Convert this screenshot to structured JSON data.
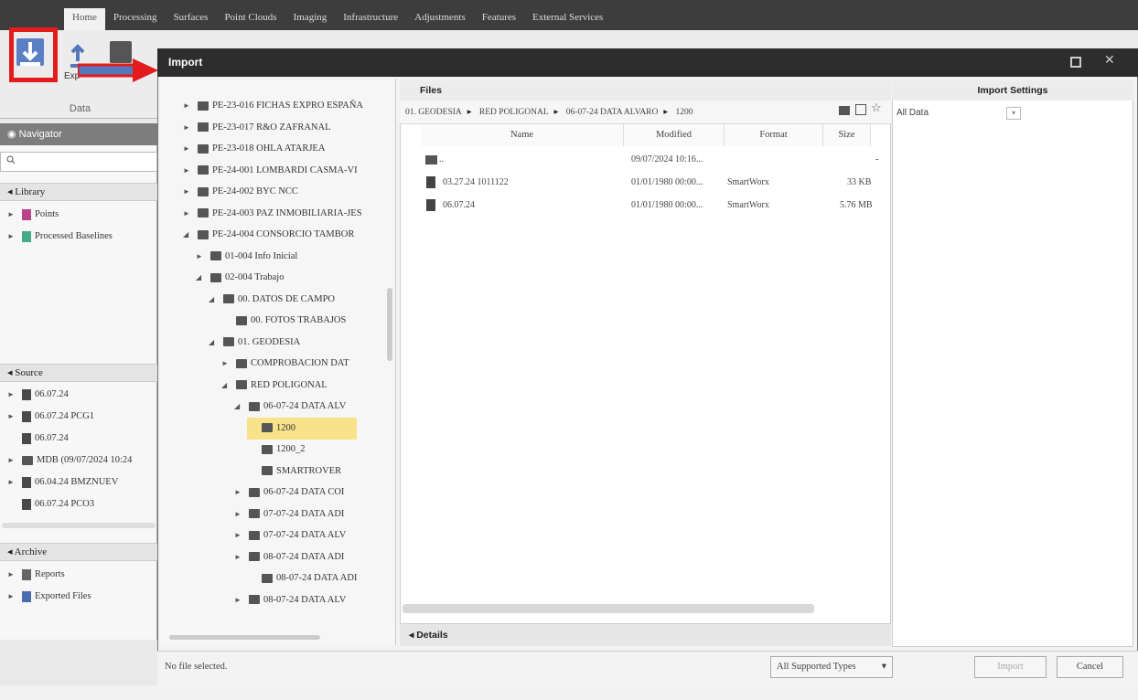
{
  "menubar": {
    "tabs": [
      "Home",
      "Processing",
      "Surfaces",
      "Point Clouds",
      "Imaging",
      "Infrastructure",
      "Adjustments",
      "Features",
      "External Services"
    ]
  },
  "ribbon": {
    "group_data": "Data",
    "export_label": "Exp"
  },
  "navigator": {
    "title": "Navigator",
    "search_placeholder": "",
    "library": {
      "label": "Library",
      "items": [
        "Points",
        "Processed Baselines"
      ]
    },
    "source": {
      "label": "Source",
      "items": [
        "06.07.24",
        "06.07.24 PCG1",
        "06.07.24",
        "MDB (09/07/2024 10:24",
        "06.04.24 BMZNUEV",
        "06.07.24 PCO3"
      ]
    },
    "archive": {
      "label": "Archive",
      "items": [
        "Reports",
        "Exported Files"
      ]
    }
  },
  "dialog": {
    "title": "Import",
    "tree": [
      "PE-23-016 FICHAS EXPRO ESPAÑA",
      "PE-23-017 R&O ZAFRANAL",
      "PE-23-018 OHLA ATARJEA",
      "PE-24-001 LOMBARDI CASMA-VI",
      "PE-24-002 BYC NCC",
      "PE-24-003 PAZ INMOBILIARIA-JES",
      "PE-24-004 CONSORCIO TAMBOR",
      "01-004 Info Inicial",
      "02-004 Trabajo",
      "00. DATOS DE CAMPO",
      "00. FOTOS TRABAJOS",
      "01. GEODESIA",
      "COMPROBACION DAT",
      "RED POLIGONAL",
      "06-07-24 DATA ALV",
      "1200",
      "1200_2",
      "SMARTROVER",
      "06-07-24 DATA COI",
      "07-07-24 DATA ADI",
      "07-07-24 DATA ALV",
      "08-07-24 DATA ADI",
      "08-07-24 DATA ADI",
      "08-07-24 DATA ALV"
    ],
    "files_label": "Files",
    "breadcrumb": [
      "01. GEODESIA",
      "RED POLIGONAL",
      "06-07-24 DATA ALVARO",
      "1200"
    ],
    "columns": [
      "Name",
      "Modified",
      "Format",
      "Size"
    ],
    "rows": [
      {
        "name": "..",
        "modified": "09/07/2024 10:16...",
        "format": "",
        "size": "-"
      },
      {
        "name": "03.27.24 1011122",
        "modified": "01/01/1980 00:00...",
        "format": "SmartWorx",
        "size": "33 KB"
      },
      {
        "name": "06.07.24",
        "modified": "01/01/1980 00:00...",
        "format": "SmartWorx",
        "size": "5.76 MB"
      }
    ],
    "details_label": "Details",
    "settings_label": "Import Settings",
    "settings_value": "All Data",
    "status_text": "No file selected.",
    "filter_value": "All Supported Types",
    "import_button": "Import",
    "cancel_button": "Cancel"
  }
}
